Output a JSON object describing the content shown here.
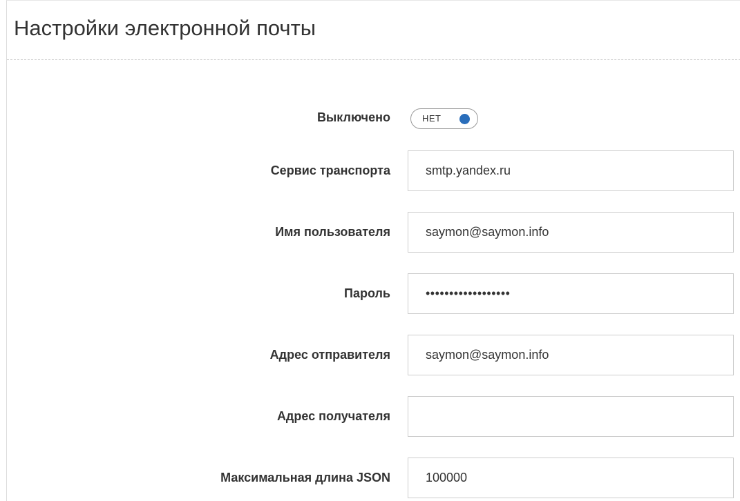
{
  "header": {
    "title": "Настройки электронной почты"
  },
  "form": {
    "disabled": {
      "label": "Выключено",
      "toggle_text": "НЕТ"
    },
    "transport": {
      "label": "Сервис транспорта",
      "value": "smtp.yandex.ru"
    },
    "username": {
      "label": "Имя пользователя",
      "value": "saymon@saymon.info"
    },
    "password": {
      "label": "Пароль",
      "value": "••••••••••••••••••"
    },
    "sender": {
      "label": "Адрес отправителя",
      "value": "saymon@saymon.info"
    },
    "recipient": {
      "label": "Адрес получателя",
      "value": ""
    },
    "max_json": {
      "label": "Максимальная длина JSON",
      "value": "100000"
    }
  },
  "colors": {
    "toggle_knob": "#2a6ebb",
    "border": "#cccccc"
  }
}
